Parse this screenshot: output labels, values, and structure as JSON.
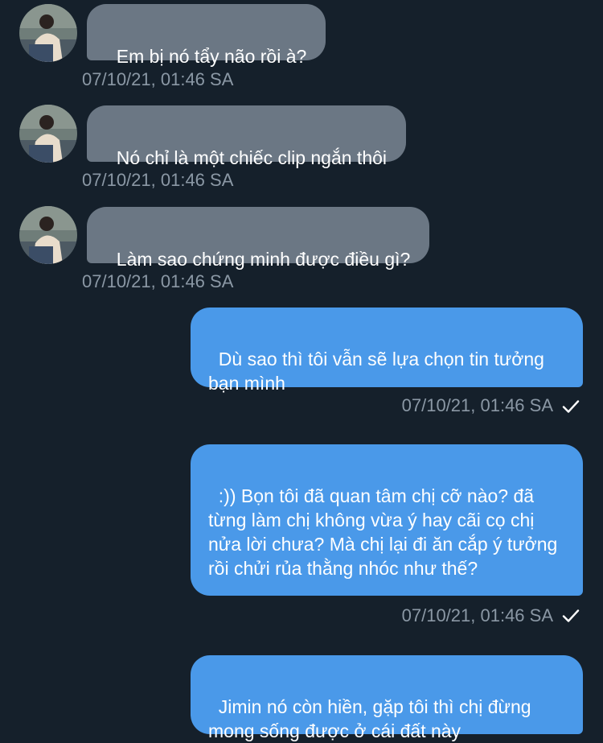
{
  "conversation": {
    "messages": [
      {
        "direction": "incoming",
        "text": "Em bị nó tẩy não rồi à?",
        "timestamp": "07/10/21, 01:46 SA"
      },
      {
        "direction": "incoming",
        "text": "Nó chỉ là một chiếc clip ngắn thôi",
        "timestamp": "07/10/21, 01:46 SA"
      },
      {
        "direction": "incoming",
        "text": "Làm sao chứng minh được điều gì?",
        "timestamp": "07/10/21, 01:46 SA"
      },
      {
        "direction": "outgoing",
        "text": "Dù sao thì tôi vẫn sẽ lựa chọn tin tưởng bạn mình",
        "timestamp": "07/10/21, 01:46 SA",
        "status_icon": "check-icon"
      },
      {
        "direction": "outgoing",
        "text": ":)) Bọn tôi đã quan tâm chị cỡ nào? đã từng làm chị không vừa ý hay cãi cọ chị nửa lời chưa? Mà chị lại đi ăn cắp ý tưởng rồi chửi rủa thằng nhóc như thế?",
        "timestamp": "07/10/21, 01:46 SA",
        "status_icon": "check-icon"
      },
      {
        "direction": "outgoing",
        "text": "Jimin nó còn hiền, gặp tôi thì chị đừng mong sống được ở cái đất này"
      }
    ]
  },
  "colors": {
    "background": "#15202b",
    "incoming_bubble": "#6b7784",
    "outgoing_bubble": "#4a99e9",
    "timestamp_text": "#8b98a5"
  }
}
